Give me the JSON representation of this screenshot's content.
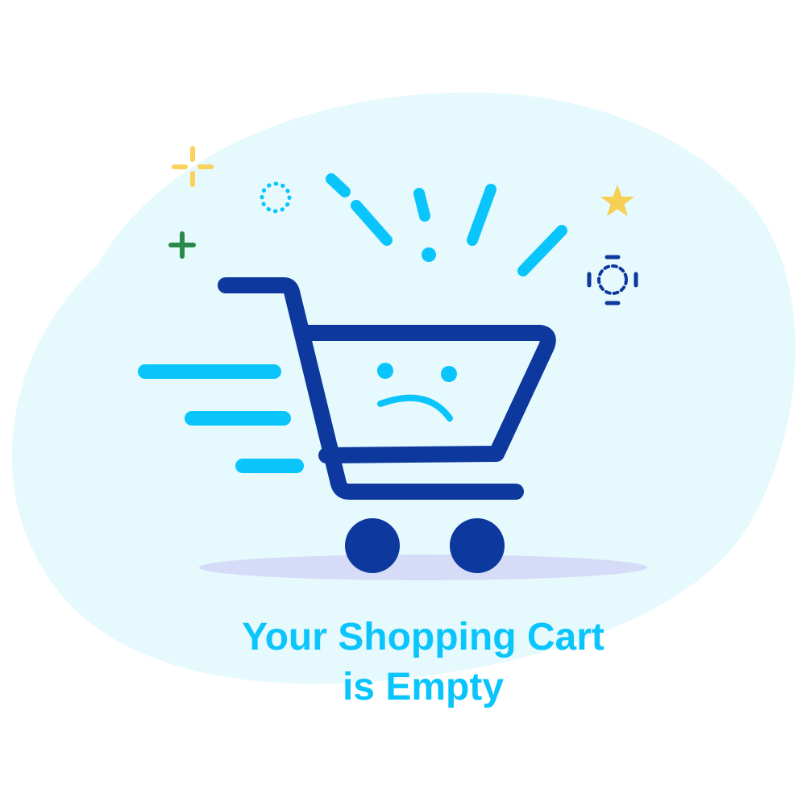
{
  "empty_state": {
    "title_line1": "Your Shopping Cart",
    "title_line2": "is Empty",
    "icon": "sad-shopping-cart-icon"
  },
  "colors": {
    "text": "#0ac5fb",
    "cart": "#0d389d",
    "accent": "#0ac5fb",
    "blob": "#e6f9fd",
    "shadow": "#d6dcf8",
    "sparkle_yellow": "#f9d25d",
    "sparkle_green": "#2a8a4b",
    "star": "#f6cf55"
  }
}
